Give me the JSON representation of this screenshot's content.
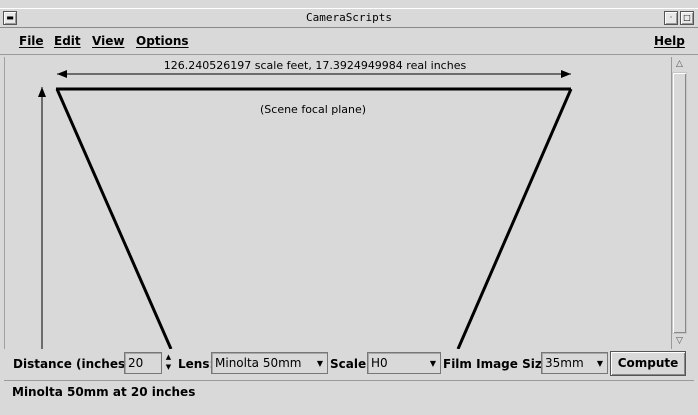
{
  "window": {
    "title": "CameraScripts"
  },
  "menu": {
    "file": "File",
    "edit": "Edit",
    "view": "View",
    "options": "Options",
    "help": "Help"
  },
  "canvas": {
    "dimension_label": "126.240526197 scale feet, 17.3924949984 real inches",
    "focal_plane_label": "(Scene focal plane)"
  },
  "controls": {
    "distance_label": "Distance (inches):",
    "distance_value": "20",
    "lens_label": "Lens:",
    "lens_value": "Minolta 50mm",
    "scale_label": "Scale:",
    "scale_value": "H0",
    "film_label": "Film Image Size:",
    "film_value": "35mm",
    "compute_label": "Compute"
  },
  "status": {
    "text": "Minolta 50mm at 20 inches"
  },
  "icons": {
    "minimize": "minimize-icon",
    "maximize": "maximize-icon",
    "menu": "window-menu-icon"
  }
}
